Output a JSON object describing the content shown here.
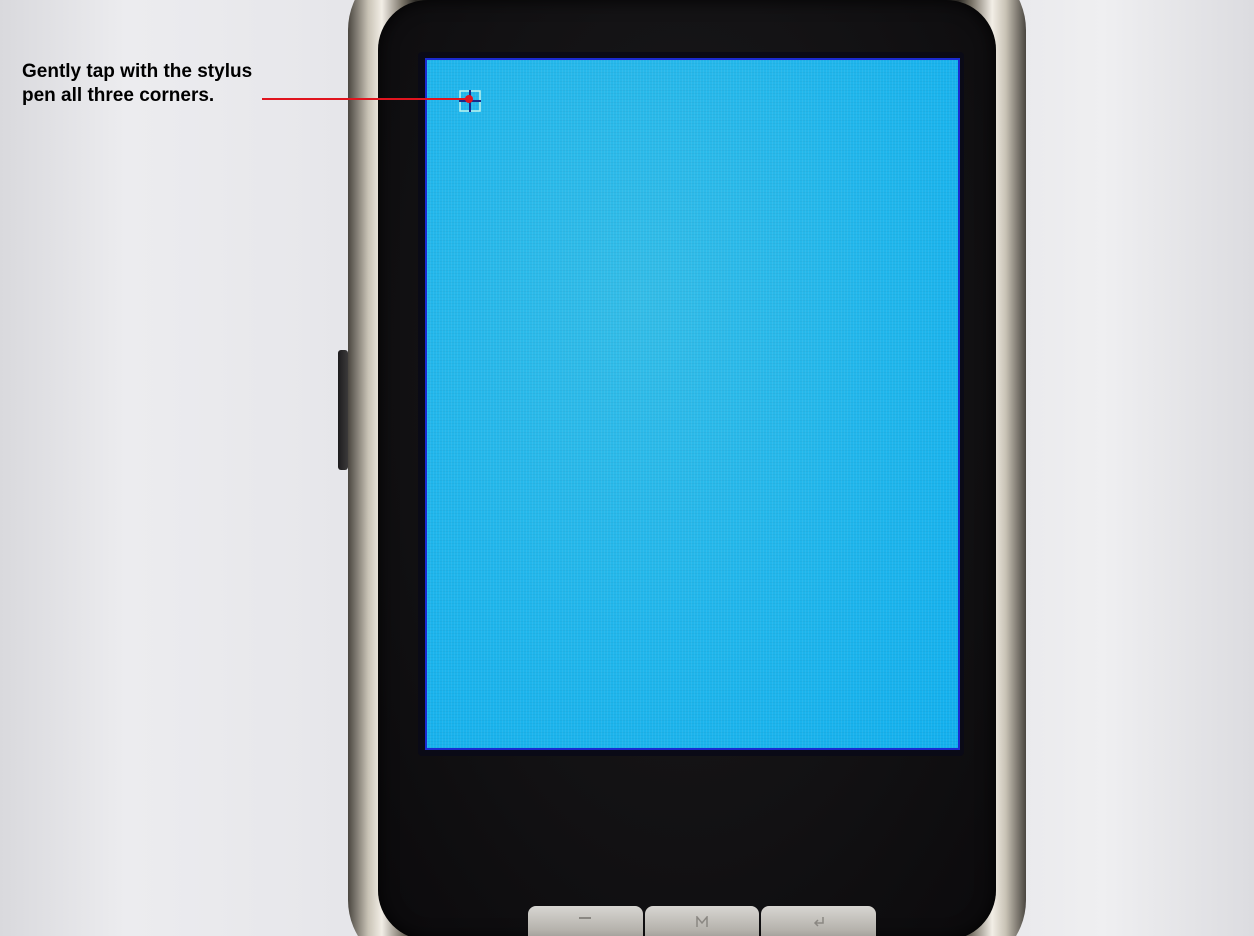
{
  "instruction": {
    "line1": "Gently tap with the stylus",
    "line2": "pen all three corners."
  },
  "colors": {
    "screen": "#20b6ec",
    "callout": "#e0141e",
    "device_face": "#121113",
    "background": "#e6e6ea"
  },
  "device": {
    "screen_prompt": "touch-calibration",
    "target_icon": "crosshair-icon",
    "hardware_buttons": [
      {
        "icon": "minus-icon"
      },
      {
        "icon": "menu-icon"
      },
      {
        "icon": "return-icon"
      }
    ]
  }
}
